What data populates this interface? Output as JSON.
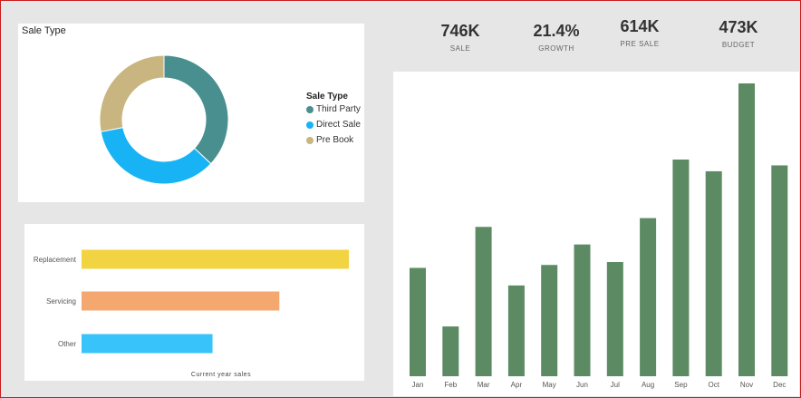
{
  "kpis": [
    {
      "value": "746K",
      "label": "SALE"
    },
    {
      "value": "21.4%",
      "label": "GROWTH"
    },
    {
      "value": "614K",
      "label": "PRE SALE"
    },
    {
      "value": "473K",
      "label": "BUDGET"
    }
  ],
  "chart_data": [
    {
      "type": "pie",
      "title": "Sale Type",
      "legend_title": "Sale Type",
      "legend_position": "right",
      "donut": true,
      "categories": [
        "Third Party",
        "Direct Sale",
        "Pre Book"
      ],
      "values": [
        37,
        35,
        28
      ],
      "colors": [
        "#4a8f8f",
        "#17b3f5",
        "#c9b57f"
      ]
    },
    {
      "type": "bar",
      "orientation": "horizontal",
      "categories": [
        "Replacement",
        "Servicing",
        "Other"
      ],
      "values": [
        100,
        74,
        49
      ],
      "colors": [
        "#f2d443",
        "#f4a870",
        "#38c3fa"
      ],
      "xlabel": "Current year sales",
      "xlim": [
        0,
        100
      ]
    },
    {
      "type": "bar",
      "categories": [
        "Jan",
        "Feb",
        "Mar",
        "Apr",
        "May",
        "Jun",
        "Jul",
        "Aug",
        "Sep",
        "Oct",
        "Nov",
        "Dec"
      ],
      "values": [
        37,
        17,
        51,
        31,
        38,
        45,
        39,
        54,
        74,
        70,
        100,
        72
      ],
      "ylim": [
        0,
        100
      ],
      "color": "#5c8a63"
    }
  ]
}
